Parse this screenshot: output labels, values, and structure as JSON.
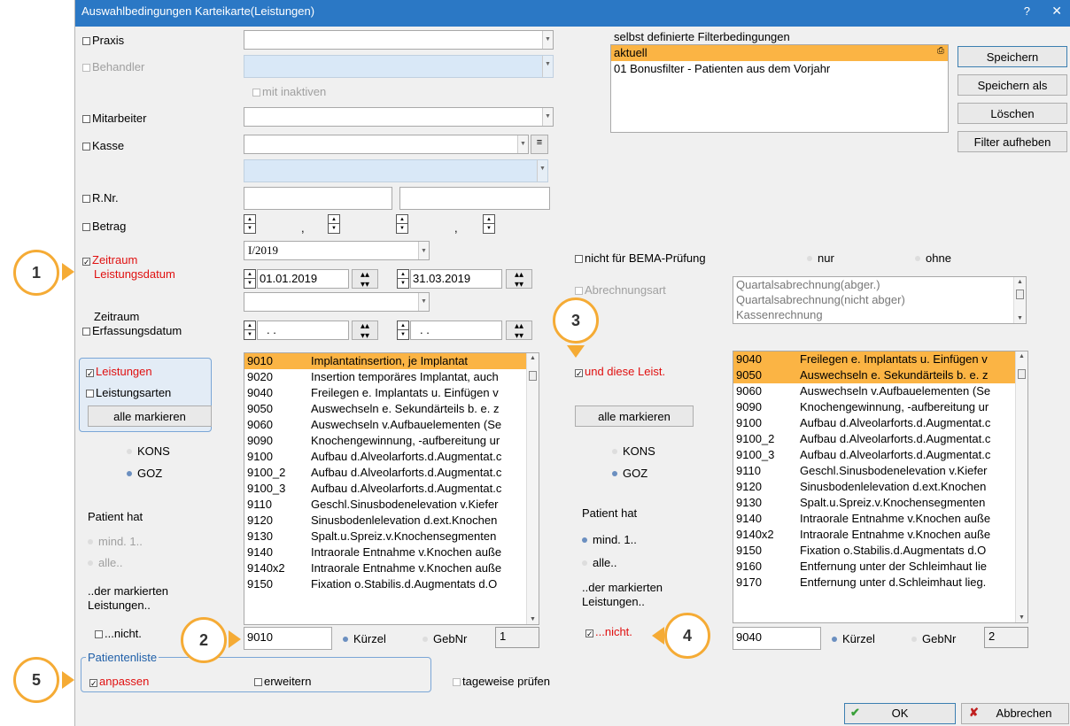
{
  "title": "Auswahlbedingungen Karteikarte(Leistungen)",
  "title_help": "?",
  "title_close": "✕",
  "left": {
    "praxis": "Praxis",
    "behandler": "Behandler",
    "mit_inaktiven": "mit inaktiven",
    "mitarbeiter": "Mitarbeiter",
    "kasse": "Kasse",
    "rnr": "R.Nr.",
    "betrag": "Betrag",
    "betrag_sep1": ",",
    "betrag_sep2": ",",
    "zeitraum_leistung_1": "Zeitraum",
    "zeitraum_leistung_2": "Leistungsdatum",
    "quartal": "I/2019",
    "date_from": "01.01.2019",
    "date_to": "31.03.2019",
    "zeitraum_erf_1": "Zeitraum",
    "zeitraum_erf_2": "Erfassungsdatum",
    "erf_from": ". .",
    "erf_to": ". ."
  },
  "filter": {
    "heading": "selbst definierte Filterbedingungen",
    "items": [
      "aktuell",
      "01 Bonusfilter - Patienten aus dem Vorjahr"
    ],
    "btn_save": "Speichern",
    "btn_save_as": "Speichern als",
    "btn_delete": "Löschen",
    "btn_clear": "Filter aufheben"
  },
  "mid": {
    "nicht_bema": "nicht für BEMA-Prüfung",
    "nur": "nur",
    "ohne": "ohne",
    "abrechnungsart": "Abrechnungsart",
    "abr_items": [
      "Quartalsabrechnung(abger.)",
      "Quartalsabrechnung(nicht abger)",
      "Kassenrechnung"
    ]
  },
  "leistungen": {
    "label": "Leistungen",
    "arten": "Leistungsarten",
    "alle_markieren": "alle markieren",
    "kons": "KONS",
    "goz": "GOZ",
    "patient_hat": "Patient hat",
    "mind": "mind. 1..",
    "alle": "alle..",
    "der_markierten_1": "..der markierten",
    "der_markierten_2": "Leistungen..",
    "nicht": "...nicht.",
    "code_value": "9010",
    "kuerzel": "Kürzel",
    "gebnr": "GebNr",
    "count": "1",
    "rows": [
      {
        "c": "9010",
        "d": "Implantatinsertion, je Implantat"
      },
      {
        "c": "9020",
        "d": "Insertion temporäres Implantat, auch"
      },
      {
        "c": "9040",
        "d": "Freilegen e. Implantats u. Einfügen v"
      },
      {
        "c": "9050",
        "d": "Auswechseln e. Sekundärteils b. e. z"
      },
      {
        "c": "9060",
        "d": "Auswechseln v.Aufbauelementen (Se"
      },
      {
        "c": "9090",
        "d": "Knochengewinnung, -aufbereitung ur"
      },
      {
        "c": "9100",
        "d": "Aufbau d.Alveolarforts.d.Augmentat.c"
      },
      {
        "c": "9100_2",
        "d": "Aufbau d.Alveolarforts.d.Augmentat.c"
      },
      {
        "c": "9100_3",
        "d": "Aufbau d.Alveolarforts.d.Augmentat.c"
      },
      {
        "c": "9110",
        "d": "Geschl.Sinusbodenelevation v.Kiefer"
      },
      {
        "c": "9120",
        "d": "Sinusbodenlelevation d.ext.Knochen"
      },
      {
        "c": "9130",
        "d": "Spalt.u.Spreiz.v.Knochensegmenten"
      },
      {
        "c": "9140",
        "d": "Intraorale Entnahme v.Knochen auße"
      },
      {
        "c": "9140x2",
        "d": "Intraorale Entnahme v.Knochen auße"
      },
      {
        "c": "9150",
        "d": "Fixation o.Stabilis.d.Augmentats d.O"
      }
    ]
  },
  "und": {
    "label": "und diese Leist.",
    "alle_markieren": "alle markieren",
    "kons": "KONS",
    "goz": "GOZ",
    "patient_hat": "Patient hat",
    "mind": "mind. 1..",
    "alle": "alle..",
    "der_markierten_1": "..der markierten",
    "der_markierten_2": "Leistungen..",
    "nicht": "...nicht.",
    "code_value": "9040",
    "kuerzel": "Kürzel",
    "gebnr": "GebNr",
    "count": "2",
    "rows": [
      {
        "c": "9040",
        "d": "Freilegen e. Implantats u. Einfügen v"
      },
      {
        "c": "9050",
        "d": "Auswechseln e. Sekundärteils b. e. z"
      },
      {
        "c": "9060",
        "d": "Auswechseln v.Aufbauelementen (Se"
      },
      {
        "c": "9090",
        "d": "Knochengewinnung, -aufbereitung ur"
      },
      {
        "c": "9100",
        "d": "Aufbau d.Alveolarforts.d.Augmentat.c"
      },
      {
        "c": "9100_2",
        "d": "Aufbau d.Alveolarforts.d.Augmentat.c"
      },
      {
        "c": "9100_3",
        "d": "Aufbau d.Alveolarforts.d.Augmentat.c"
      },
      {
        "c": "9110",
        "d": "Geschl.Sinusbodenelevation v.Kiefer"
      },
      {
        "c": "9120",
        "d": "Sinusbodenlelevation d.ext.Knochen"
      },
      {
        "c": "9130",
        "d": "Spalt.u.Spreiz.v.Knochensegmenten"
      },
      {
        "c": "9140",
        "d": "Intraorale Entnahme v.Knochen auße"
      },
      {
        "c": "9140x2",
        "d": "Intraorale Entnahme v.Knochen auße"
      },
      {
        "c": "9150",
        "d": "Fixation o.Stabilis.d.Augmentats d.O"
      },
      {
        "c": "9160",
        "d": "Entfernung unter der Schleimhaut lie"
      },
      {
        "c": "9170",
        "d": "Entfernung unter d.Schleimhaut lieg."
      }
    ]
  },
  "patientenliste": {
    "heading": "Patientenliste",
    "anpassen": "anpassen",
    "erweitern": "erweitern",
    "tageweise": "tageweise prüfen"
  },
  "footer": {
    "ok": "OK",
    "cancel": "Abbrechen"
  },
  "callouts": [
    "1",
    "2",
    "3",
    "4",
    "5"
  ],
  "colors": {
    "title_bar": "#2b78c5",
    "selection": "#fbb444",
    "callout": "#f5ab35",
    "accent_red": "#e01010"
  }
}
